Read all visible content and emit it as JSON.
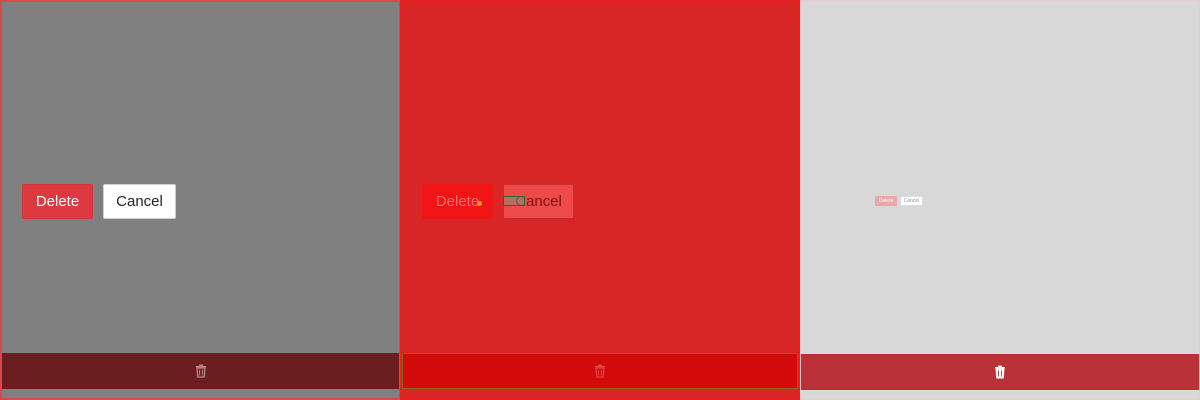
{
  "panels": [
    {
      "delete_label": "Delete",
      "cancel_label": "Cancel",
      "footer_icon": "trash-icon"
    },
    {
      "delete_label": "Delete",
      "cancel_label": "Cancel",
      "footer_icon": "trash-icon"
    },
    {
      "delete_label": "Delete",
      "cancel_label": "Cancel",
      "footer_icon": "trash-icon"
    }
  ],
  "colors": {
    "danger": "#dc3a40",
    "footer_dark": "#6a1e20",
    "footer_bright": "#d20a0a",
    "footer_muted": "#b93136",
    "panel_gray": "#808080",
    "panel_red": "#d82626",
    "panel_light": "#d8d8d8"
  }
}
